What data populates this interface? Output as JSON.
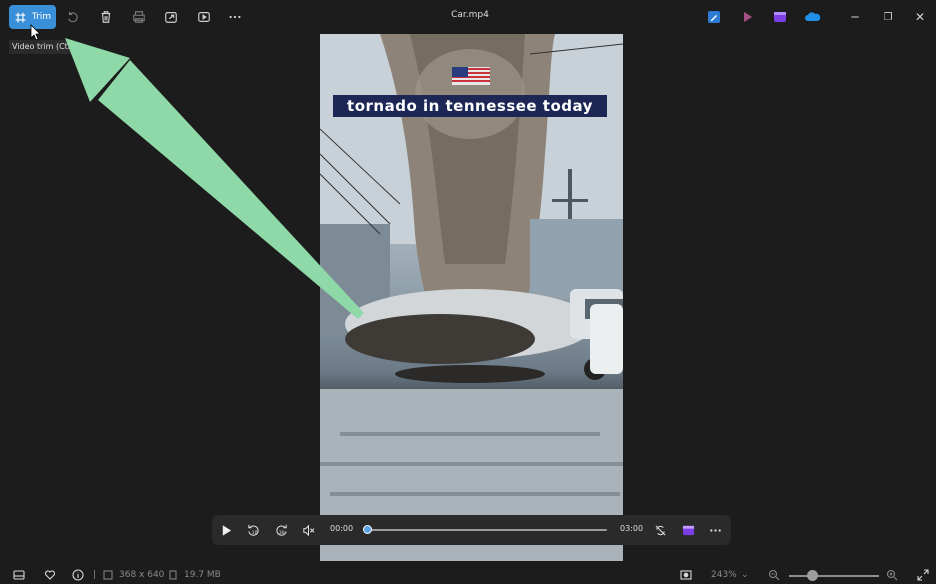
{
  "window": {
    "title": "Car.mp4"
  },
  "toolbar": {
    "trim_label": "Trim",
    "tooltip": "Video trim (Ctrl",
    "icons": [
      "trim-icon",
      "rotate-icon",
      "delete-icon",
      "print-icon",
      "share-icon",
      "slideshow-icon",
      "more-icon"
    ]
  },
  "app_icons": [
    "edit-app-icon",
    "clipchamp-icon",
    "video-editor-icon",
    "onedrive-icon"
  ],
  "window_controls": [
    "minimize",
    "restore",
    "close"
  ],
  "video": {
    "caption": "tornado in tennessee today"
  },
  "player": {
    "current_time": "00:00",
    "duration": "03:00",
    "progress": 0,
    "icons": [
      "play-icon",
      "rewind-10-icon",
      "forward-30-icon",
      "mute-icon",
      "loop-icon",
      "clipchamp-icon",
      "more-icon"
    ]
  },
  "status": {
    "dimensions": "368 x 640",
    "filesize": "19.7 MB",
    "zoom": "243%",
    "zoom_level": 0.25
  },
  "colors": {
    "accent": "#3a8fd9",
    "arrow": "#8fd9a8",
    "background": "#1c1c1c"
  }
}
